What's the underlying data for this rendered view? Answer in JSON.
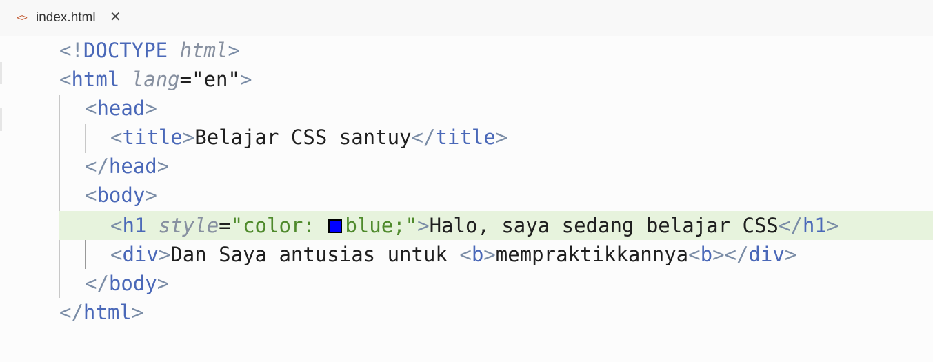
{
  "tab": {
    "icon": "code-brackets-icon",
    "filename": "index.html",
    "close": "✕"
  },
  "code": {
    "l1": {
      "open": "<!",
      "tag": "DOCTYPE",
      "attr": "html",
      "close": ">"
    },
    "l2": {
      "open": "<",
      "tag": "html",
      "attr": "lang",
      "eq": "=",
      "val": "\"en\"",
      "close": ">"
    },
    "l3": {
      "open": "<",
      "tag": "head",
      "close": ">"
    },
    "l4": {
      "open": "<",
      "tag": "title",
      "close": ">",
      "text": "Belajar CSS santuy",
      "open2": "</",
      "tag2": "title",
      "close2": ">"
    },
    "l5": {
      "open": "</",
      "tag": "head",
      "close": ">"
    },
    "l6": {
      "open": "<",
      "tag": "body",
      "close": ">"
    },
    "l7": {
      "open": "<",
      "tag": "h1",
      "attr": "style",
      "eq": "=",
      "val_a": "\"color: ",
      "swatch_color": "#0000ff",
      "val_b": "blue;\"",
      "close": ">",
      "text": "Halo, saya sedang belajar CSS",
      "open2": "</",
      "tag2": "h1",
      "close2": ">"
    },
    "l8": {
      "open": "<",
      "tag": "div",
      "close": ">",
      "text": "Dan Saya antusias untuk ",
      "b_open": "<",
      "b_tag": "b",
      "b_close": ">",
      "text2": "mempraktikkannya",
      "b2_open": "<",
      "b2_tag": "b",
      "b2_close": ">",
      "open2": "</",
      "tag2": "div",
      "close2": ">"
    },
    "l9": {
      "open": "</",
      "tag": "body",
      "close": ">"
    },
    "l10": {
      "open": "</",
      "tag": "html",
      "close": ">"
    }
  }
}
